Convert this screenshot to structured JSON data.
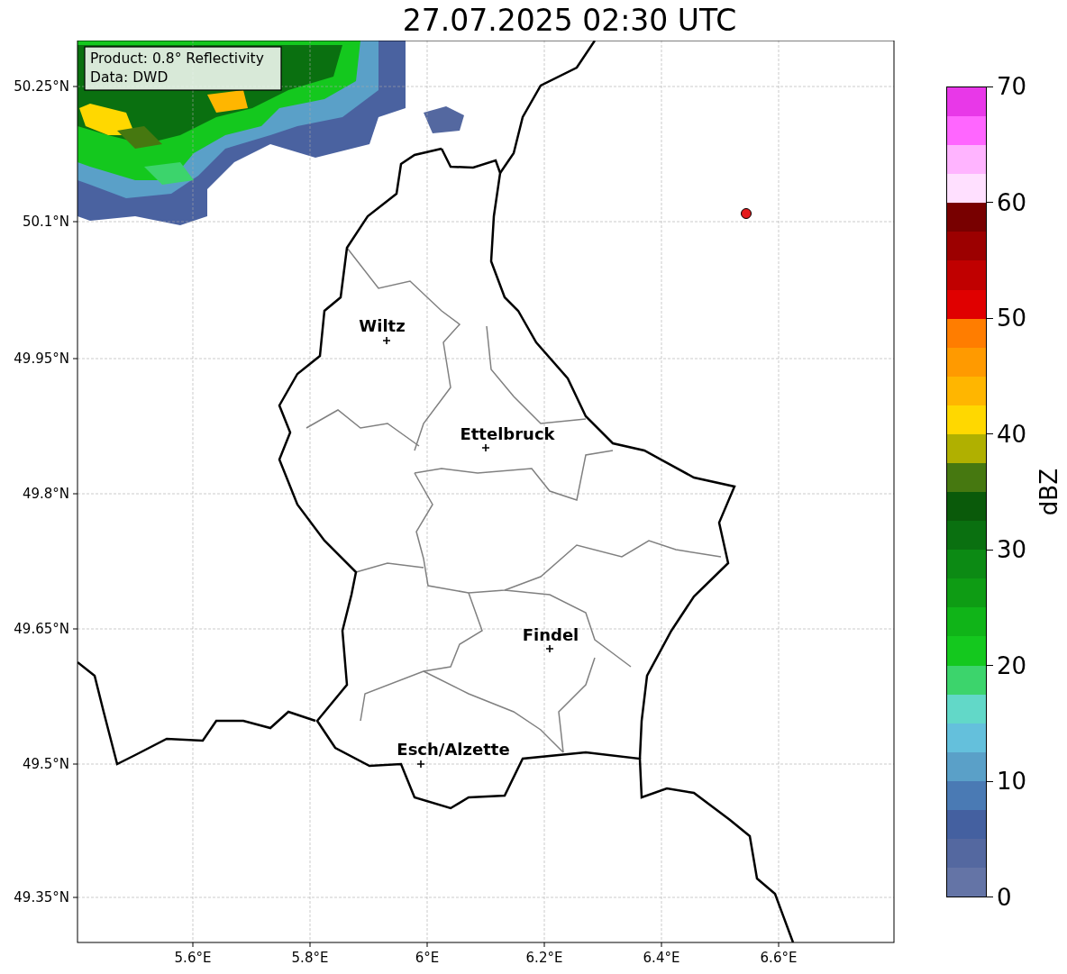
{
  "title": "27.07.2025 02:30 UTC",
  "info_box": {
    "lines": [
      "Product: 0.8° Reflectivity",
      "Data: DWD"
    ]
  },
  "map": {
    "x_ticks": [
      "5.6°E",
      "5.8°E",
      "6°E",
      "6.2°E",
      "6.4°E",
      "6.6°E"
    ],
    "y_ticks": [
      "50.25°N",
      "50.1°N",
      "49.95°N",
      "49.8°N",
      "49.65°N",
      "49.5°N",
      "49.35°N"
    ],
    "cities": [
      {
        "name": "Wiltz"
      },
      {
        "name": "Ettelbruck"
      },
      {
        "name": "Findel"
      },
      {
        "name": "Esch/Alzette"
      }
    ],
    "radar_marker": {
      "color": "#e41a1c"
    }
  },
  "colorbar": {
    "label": "dBZ",
    "ticks": [
      "70",
      "60",
      "50",
      "40",
      "30",
      "20",
      "10",
      "0"
    ],
    "bands": [
      {
        "color": "#e838e8"
      },
      {
        "color": "#ff66ff"
      },
      {
        "color": "#ffb4ff"
      },
      {
        "color": "#ffe0ff"
      },
      {
        "color": "#780000"
      },
      {
        "color": "#9c0000"
      },
      {
        "color": "#c00000"
      },
      {
        "color": "#e00000"
      },
      {
        "color": "#ff7d00"
      },
      {
        "color": "#ff9a00"
      },
      {
        "color": "#ffb600"
      },
      {
        "color": "#ffd800"
      },
      {
        "color": "#b0b000"
      },
      {
        "color": "#467810"
      },
      {
        "color": "#0a5a0a"
      },
      {
        "color": "#0a7010"
      },
      {
        "color": "#0c8a14"
      },
      {
        "color": "#0e9c14"
      },
      {
        "color": "#10b418"
      },
      {
        "color": "#14c81e"
      },
      {
        "color": "#3cd46c"
      },
      {
        "color": "#62d8c8"
      },
      {
        "color": "#64c0dc"
      },
      {
        "color": "#5aa0c8"
      },
      {
        "color": "#4a7ab4"
      },
      {
        "color": "#4460a0"
      },
      {
        "color": "#5468a0"
      },
      {
        "color": "#6474a6"
      }
    ]
  }
}
